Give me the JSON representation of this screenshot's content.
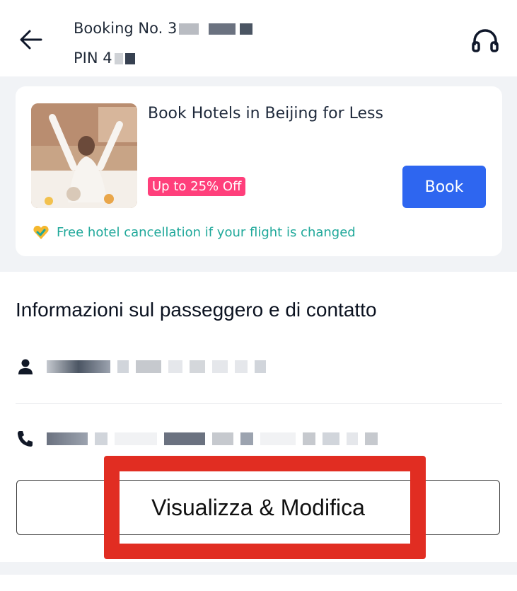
{
  "header": {
    "booking_label": "Booking No. 3",
    "pin_label": "PIN 4"
  },
  "hotel_card": {
    "title": "Book Hotels in Beijing for Less",
    "discount": "Up to 25% Off",
    "book_label": "Book",
    "free_cancellation": "Free hotel cancellation if your flight is changed"
  },
  "passenger_section": {
    "title": "Informazioni sul passeggero e di contatto",
    "view_modify_label": "Visualizza & Modifica"
  },
  "colors": {
    "accent_blue": "#2e66f0",
    "discount_pink": "#ff3f7b",
    "teal": "#1fa89a",
    "highlight_red": "#e12d22"
  }
}
